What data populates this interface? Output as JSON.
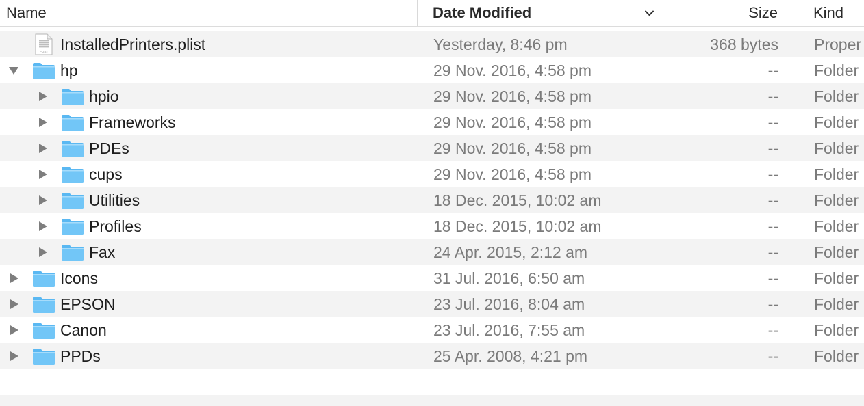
{
  "columns": {
    "name": "Name",
    "date": "Date Modified",
    "size": "Size",
    "kind": "Kind"
  },
  "sort": {
    "column": "date",
    "direction": "descending",
    "indicator": "chevron-down-icon"
  },
  "colors": {
    "folder_body": "#72c6f7",
    "folder_tab": "#5ab8f2",
    "text_primary": "#1e1e1e",
    "text_secondary": "#7b7b7b",
    "row_alt": "#f3f3f3"
  },
  "rows": [
    {
      "depth": 0,
      "disclosure": "none",
      "icon": "plist-file-icon",
      "name": "InstalledPrinters.plist",
      "date": "Yesterday, 8:46 pm",
      "size": "368 bytes",
      "kind": "Proper",
      "file_badge": "PLIST"
    },
    {
      "depth": 0,
      "disclosure": "expanded",
      "icon": "folder-icon",
      "name": "hp",
      "date": "29 Nov. 2016, 4:58 pm",
      "size": "--",
      "kind": "Folder"
    },
    {
      "depth": 1,
      "disclosure": "collapsed",
      "icon": "folder-icon",
      "name": "hpio",
      "date": "29 Nov. 2016, 4:58 pm",
      "size": "--",
      "kind": "Folder"
    },
    {
      "depth": 1,
      "disclosure": "collapsed",
      "icon": "folder-icon",
      "name": "Frameworks",
      "date": "29 Nov. 2016, 4:58 pm",
      "size": "--",
      "kind": "Folder"
    },
    {
      "depth": 1,
      "disclosure": "collapsed",
      "icon": "folder-icon",
      "name": "PDEs",
      "date": "29 Nov. 2016, 4:58 pm",
      "size": "--",
      "kind": "Folder"
    },
    {
      "depth": 1,
      "disclosure": "collapsed",
      "icon": "folder-icon",
      "name": "cups",
      "date": "29 Nov. 2016, 4:58 pm",
      "size": "--",
      "kind": "Folder"
    },
    {
      "depth": 1,
      "disclosure": "collapsed",
      "icon": "folder-icon",
      "name": "Utilities",
      "date": "18 Dec. 2015, 10:02 am",
      "size": "--",
      "kind": "Folder"
    },
    {
      "depth": 1,
      "disclosure": "collapsed",
      "icon": "folder-icon",
      "name": "Profiles",
      "date": "18 Dec. 2015, 10:02 am",
      "size": "--",
      "kind": "Folder"
    },
    {
      "depth": 1,
      "disclosure": "collapsed",
      "icon": "folder-icon",
      "name": "Fax",
      "date": "24 Apr. 2015, 2:12 am",
      "size": "--",
      "kind": "Folder"
    },
    {
      "depth": 0,
      "disclosure": "collapsed",
      "icon": "folder-icon",
      "name": "Icons",
      "date": "31 Jul. 2016, 6:50 am",
      "size": "--",
      "kind": "Folder"
    },
    {
      "depth": 0,
      "disclosure": "collapsed",
      "icon": "folder-icon",
      "name": "EPSON",
      "date": "23 Jul. 2016, 8:04 am",
      "size": "--",
      "kind": "Folder"
    },
    {
      "depth": 0,
      "disclosure": "collapsed",
      "icon": "folder-icon",
      "name": "Canon",
      "date": "23 Jul. 2016, 7:55 am",
      "size": "--",
      "kind": "Folder"
    },
    {
      "depth": 0,
      "disclosure": "collapsed",
      "icon": "folder-icon",
      "name": "PPDs",
      "date": "25 Apr. 2008, 4:21 pm",
      "size": "--",
      "kind": "Folder"
    }
  ]
}
